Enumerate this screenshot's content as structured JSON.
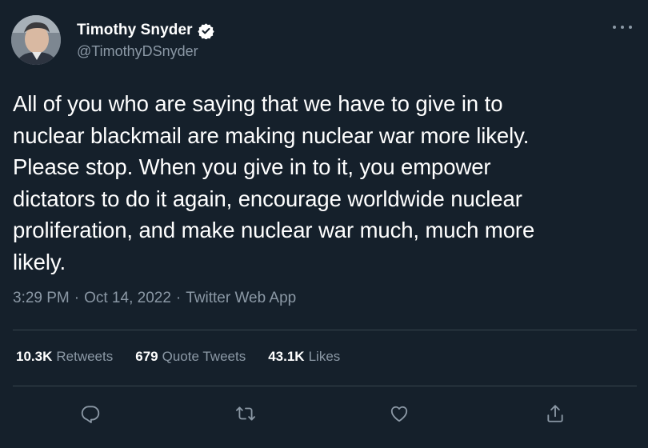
{
  "author": {
    "display_name": "Timothy Snyder",
    "handle": "@TimothyDSnyder",
    "verified": true
  },
  "tweet": {
    "text": "All of you who are saying that we have to give in to\nnuclear blackmail are making nuclear war more likely.\nPlease stop. When you give in to it, you empower\ndictators to do it again, encourage worldwide nuclear\nproliferation, and make nuclear war much, much more\nlikely.",
    "time": "3:29 PM",
    "date": "Oct 14, 2022",
    "source": "Twitter Web App",
    "separator": "·"
  },
  "stats": {
    "retweets_count": "10.3K",
    "retweets_label": "Retweets",
    "quotes_count": "679",
    "quotes_label": "Quote Tweets",
    "likes_count": "43.1K",
    "likes_label": "Likes"
  },
  "icons": {
    "more": "more-horizontal-icon",
    "verified": "verified-badge-icon",
    "reply": "reply-icon",
    "retweet": "retweet-icon",
    "like": "heart-icon",
    "share": "share-icon"
  },
  "colors": {
    "background": "#15202b",
    "text": "#ffffff",
    "secondary": "#8b98a5",
    "divider": "#38444d",
    "verified": "#ffffff"
  }
}
